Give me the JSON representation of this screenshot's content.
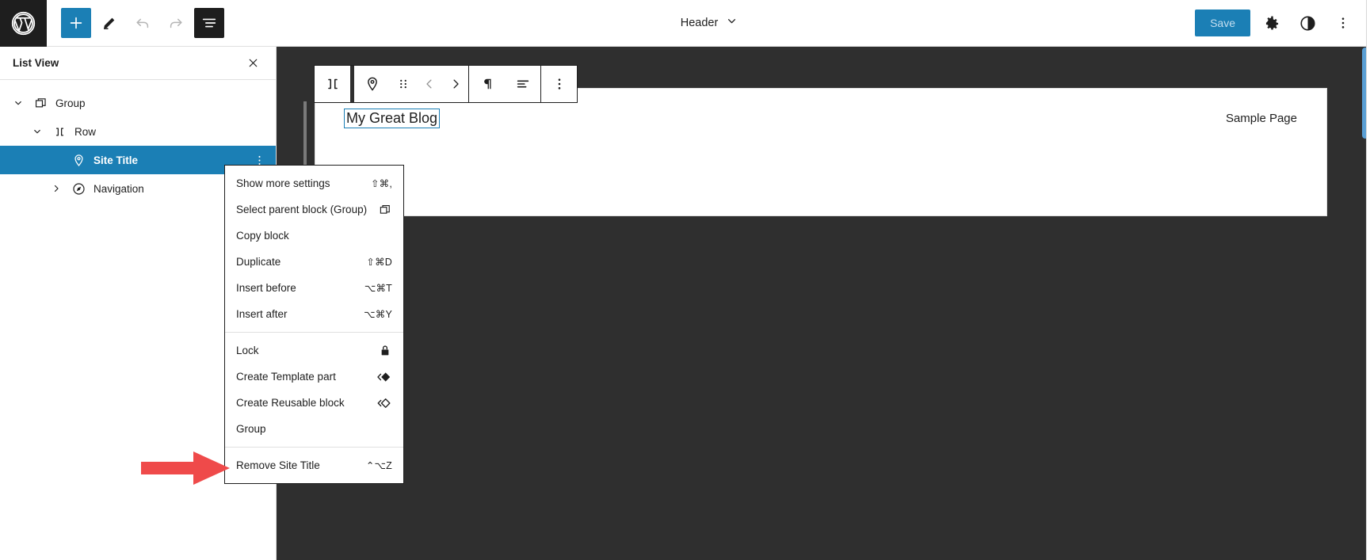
{
  "topbar": {
    "logo_icon": "wordpress-logo-icon",
    "tools": [
      {
        "name": "add-block-button",
        "icon": "plus-icon",
        "style": "primary",
        "disabled": false
      },
      {
        "name": "edit-tool-button",
        "icon": "pencil-icon",
        "style": "plain",
        "disabled": false
      },
      {
        "name": "undo-button",
        "icon": "undo-arrow-icon",
        "style": "plain",
        "disabled": true
      },
      {
        "name": "redo-button",
        "icon": "redo-arrow-icon",
        "style": "plain",
        "disabled": true
      },
      {
        "name": "list-view-button",
        "icon": "list-view-icon",
        "style": "dark",
        "disabled": false
      }
    ],
    "document_title": "Header",
    "document_title_chevron": "chevron-down-icon",
    "save_label": "Save",
    "settings_icon": "gear-icon",
    "styles_icon": "contrast-half-circle-icon",
    "options_icon": "three-vertical-dots-icon"
  },
  "list_view": {
    "title": "List View",
    "close_icon": "close-x-icon",
    "items": [
      {
        "label": "Group",
        "icon": "group-block-icon",
        "depth": 0,
        "expanded": true,
        "selected": false,
        "chevron": "chevron-down-icon"
      },
      {
        "label": "Row",
        "icon": "row-block-icon",
        "depth": 1,
        "expanded": true,
        "selected": false,
        "chevron": "chevron-down-icon"
      },
      {
        "label": "Site Title",
        "icon": "site-title-pin-icon",
        "depth": 2,
        "expanded": false,
        "selected": true,
        "chevron": "",
        "options_icon": "three-vertical-dots-icon"
      },
      {
        "label": "Navigation",
        "icon": "navigation-block-icon",
        "depth": 2,
        "expanded": false,
        "selected": false,
        "chevron": "chevron-right-icon"
      }
    ]
  },
  "block_toolbar": {
    "buttons": [
      {
        "name": "select-parent-row-button",
        "icon": "row-block-icon",
        "muted": false
      },
      {
        "name": "block-type-site-title-button",
        "icon": "site-title-pin-icon",
        "muted": false
      },
      {
        "name": "drag-handle-button",
        "icon": "drag-dots-icon",
        "muted": false
      },
      {
        "name": "move-left-button",
        "icon": "chevron-left-icon",
        "muted": true
      },
      {
        "name": "move-right-button",
        "icon": "chevron-right-icon",
        "muted": false
      },
      {
        "name": "paragraph-format-button",
        "icon": "pilcrow-icon",
        "muted": false
      },
      {
        "name": "align-text-button",
        "icon": "align-left-icon",
        "muted": false
      },
      {
        "name": "block-options-button",
        "icon": "three-vertical-dots-icon",
        "muted": false
      }
    ]
  },
  "canvas": {
    "site_title": "My Great Blog",
    "nav_item": "Sample Page"
  },
  "context_menu": {
    "sections": [
      {
        "items": [
          {
            "label": "Show more settings",
            "shortcut": "⇧⌘,",
            "icon": ""
          },
          {
            "label": "Select parent block (Group)",
            "shortcut": "",
            "icon": "group-block-icon"
          },
          {
            "label": "Copy block",
            "shortcut": "",
            "icon": ""
          },
          {
            "label": "Duplicate",
            "shortcut": "⇧⌘D",
            "icon": ""
          },
          {
            "label": "Insert before",
            "shortcut": "⌥⌘T",
            "icon": ""
          },
          {
            "label": "Insert after",
            "shortcut": "⌥⌘Y",
            "icon": ""
          }
        ]
      },
      {
        "items": [
          {
            "label": "Lock",
            "shortcut": "",
            "icon": "padlock-icon"
          },
          {
            "label": "Create Template part",
            "shortcut": "",
            "icon": "template-part-icon"
          },
          {
            "label": "Create Reusable block",
            "shortcut": "",
            "icon": "reusable-block-icon"
          },
          {
            "label": "Group",
            "shortcut": "",
            "icon": ""
          }
        ]
      },
      {
        "items": [
          {
            "label": "Remove Site Title",
            "shortcut": "⌃⌥Z",
            "icon": ""
          }
        ]
      }
    ]
  },
  "annotation": {
    "arrow_color": "#ef4a4a",
    "arrow_points_to": "Remove Site Title"
  },
  "colors": {
    "accent_blue": "#1b7fb5",
    "dark_chrome": "#1e1e1e",
    "canvas_bg": "#2f2f2f"
  }
}
